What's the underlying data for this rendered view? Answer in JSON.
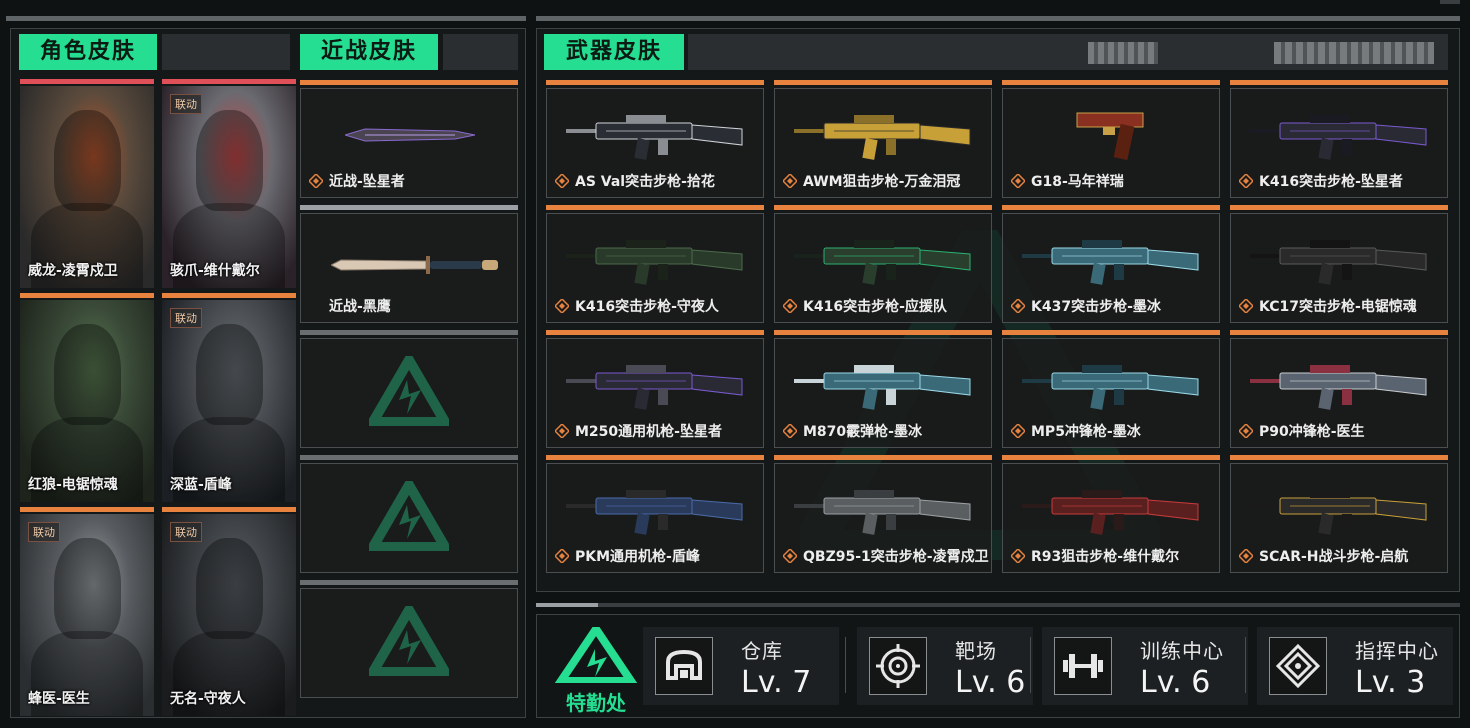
{
  "sections": {
    "character": "角色皮肤",
    "melee": "近战皮肤",
    "weapon": "武器皮肤"
  },
  "character_skins": [
    {
      "name": "威龙-凌霄戍卫",
      "tag": "",
      "bar": "#e05058"
    },
    {
      "name": "骇爪-维什戴尔",
      "tag": "联动",
      "bar": "#e05058"
    },
    {
      "name": "红狼-电锯惊魂",
      "tag": "",
      "bar": "#e8833f"
    },
    {
      "name": "深蓝-盾峰",
      "tag": "联动",
      "bar": "#e8833f"
    },
    {
      "name": "蜂医-医生",
      "tag": "联动",
      "bar": "#e8833f"
    },
    {
      "name": "无名-守夜人",
      "tag": "联动",
      "bar": "#e8833f"
    }
  ],
  "melee_skins": [
    {
      "name": "近战-坠星者",
      "bar": "#e8833f"
    },
    {
      "name": "近战-黑鹰",
      "bar": "#9aa0a4"
    },
    {
      "name": "",
      "bar": "#6a6e70"
    },
    {
      "name": "",
      "bar": "#6a6e70"
    },
    {
      "name": "",
      "bar": "#6a6e70"
    }
  ],
  "weapon_skins": [
    {
      "name": "AS Val突击步枪-拾花"
    },
    {
      "name": "AWM狙击步枪-万金泪冠"
    },
    {
      "name": "G18-马年祥瑞"
    },
    {
      "name": "K416突击步枪-坠星者"
    },
    {
      "name": "K416突击步枪-守夜人"
    },
    {
      "name": "K416突击步枪-应援队"
    },
    {
      "name": "K437突击步枪-墨冰"
    },
    {
      "name": "KC17突击步枪-电锯惊魂"
    },
    {
      "name": "M250通用机枪-坠星者"
    },
    {
      "name": "M870霰弹枪-墨冰"
    },
    {
      "name": "MP5冲锋枪-墨冰"
    },
    {
      "name": "P90冲锋枪-医生"
    },
    {
      "name": "PKM通用机枪-盾峰"
    },
    {
      "name": "QBZ95-1突击步枪-凌霄戍卫"
    },
    {
      "name": "R93狙击步枪-维什戴尔"
    },
    {
      "name": "SCAR-H战斗步枪-启航"
    }
  ],
  "special_ops": {
    "label": "特勤处",
    "facilities": [
      {
        "name": "仓库",
        "level": "Lv. 7",
        "icon": "warehouse-icon"
      },
      {
        "name": "靶场",
        "level": "Lv. 6",
        "icon": "target-icon"
      },
      {
        "name": "训练中心",
        "level": "Lv. 6",
        "icon": "dumbbell-icon"
      },
      {
        "name": "指挥中心",
        "level": "Lv. 3",
        "icon": "command-icon"
      }
    ]
  },
  "colors": {
    "accent_green": "#25de92",
    "bar_orange": "#e8833f",
    "bar_red": "#e05058"
  }
}
